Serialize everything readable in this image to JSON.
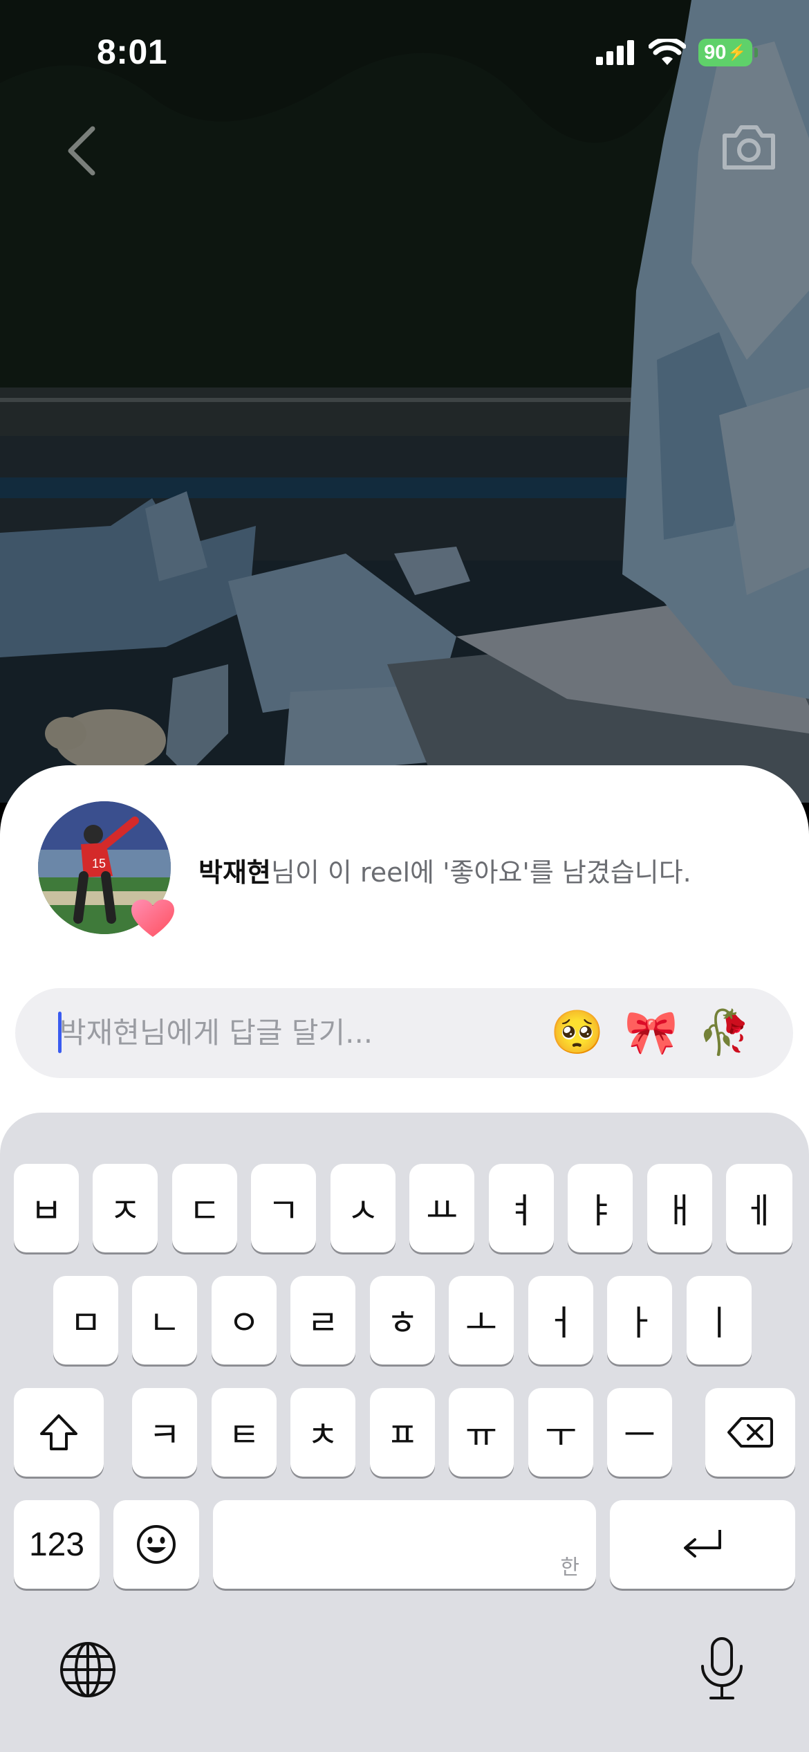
{
  "status_bar": {
    "time": "8:01",
    "battery_level": "90",
    "icons": [
      "cellular-signal-icon",
      "wifi-icon",
      "battery-charging-icon"
    ]
  },
  "nav": {
    "back_icon": "chevron-left-icon",
    "camera_icon": "camera-icon"
  },
  "notification": {
    "username": "박재현",
    "message": "님이 이 reel에 '좋아요'를 남겼습니다.",
    "badge_icon": "heart-icon"
  },
  "reply": {
    "placeholder": "박재현님에게 답글 달기...",
    "value": "",
    "quick_emojis": [
      "🥺",
      "🎀",
      "🥀"
    ]
  },
  "keyboard": {
    "row1": [
      "ㅂ",
      "ㅈ",
      "ㄷ",
      "ㄱ",
      "ㅅ",
      "ㅛ",
      "ㅕ",
      "ㅑ",
      "ㅐ",
      "ㅔ"
    ],
    "row2": [
      "ㅁ",
      "ㄴ",
      "ㅇ",
      "ㄹ",
      "ㅎ",
      "ㅗ",
      "ㅓ",
      "ㅏ",
      "ㅣ"
    ],
    "row3": [
      "ㅋ",
      "ㅌ",
      "ㅊ",
      "ㅍ",
      "ㅠ",
      "ㅜ",
      "ㅡ"
    ],
    "numbers_label": "123",
    "space_hint": "한",
    "icons": [
      "shift-icon",
      "delete-icon",
      "emoji-icon",
      "return-icon",
      "globe-icon",
      "microphone-icon"
    ]
  },
  "colors": {
    "accent_caret": "#3a5bf0",
    "battery": "#5fd16a",
    "heart": "#ff4f7a"
  }
}
